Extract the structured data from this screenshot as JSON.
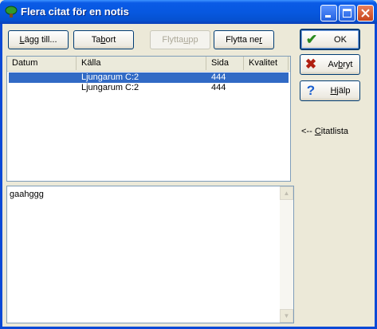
{
  "window": {
    "title": "Flera citat för en notis",
    "minimize_icon": "minimize-icon",
    "maximize_icon": "maximize-icon",
    "close_icon": "close-icon",
    "app_icon": "tree-icon"
  },
  "toolbar": {
    "add": {
      "pre": "",
      "u": "L",
      "post": "ägg till..."
    },
    "remove": {
      "pre": "Ta ",
      "u": "b",
      "post": "ort"
    },
    "move_up": {
      "pre": "Flytta ",
      "u": "u",
      "post": "pp"
    },
    "move_down": {
      "pre": "Flytta ne",
      "u": "r",
      "post": ""
    }
  },
  "actions": {
    "ok": {
      "label": "OK",
      "icon": "checkmark-icon"
    },
    "cancel": {
      "pre": "Av",
      "u": "b",
      "post": "ryt",
      "icon": "x-icon"
    },
    "help": {
      "pre": "",
      "u": "H",
      "post": "jälp",
      "icon": "question-icon"
    }
  },
  "citation_link": {
    "arrow": "<-- ",
    "pre": "",
    "u": "C",
    "post": "itatlista"
  },
  "list": {
    "columns": [
      "Datum",
      "Källa",
      "Sida",
      "Kvalitet"
    ],
    "rows": [
      {
        "datum": "",
        "kalla": "Ljungarum C:2",
        "sida": "444",
        "kvalitet": "",
        "selected": true
      },
      {
        "datum": "",
        "kalla": "Ljungarum C:2",
        "sida": "444",
        "kvalitet": "",
        "selected": false
      }
    ]
  },
  "note_text": "gaahggg",
  "colors": {
    "title_bar": "#0a5ae6",
    "selection": "#316ac5",
    "ok_check": "#2a8a1f",
    "cancel_x": "#b01e10",
    "help_q": "#1a5fd0"
  }
}
